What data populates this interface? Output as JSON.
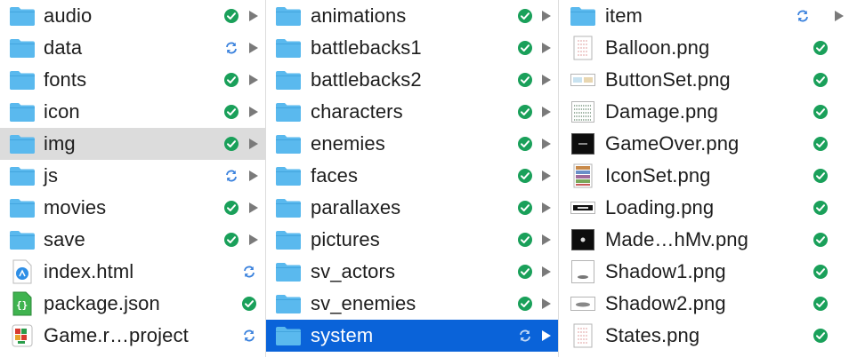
{
  "columns": [
    {
      "items": [
        {
          "name": "audio",
          "kind": "folder",
          "status": "synced",
          "arrow": true
        },
        {
          "name": "data",
          "kind": "folder",
          "status": "syncing",
          "arrow": true
        },
        {
          "name": "fonts",
          "kind": "folder",
          "status": "synced",
          "arrow": true
        },
        {
          "name": "icon",
          "kind": "folder",
          "status": "synced",
          "arrow": true
        },
        {
          "name": "img",
          "kind": "folder",
          "status": "synced",
          "arrow": true,
          "selected": "gray"
        },
        {
          "name": "js",
          "kind": "folder",
          "status": "syncing",
          "arrow": true
        },
        {
          "name": "movies",
          "kind": "folder",
          "status": "synced",
          "arrow": true
        },
        {
          "name": "save",
          "kind": "folder",
          "status": "synced",
          "arrow": true
        },
        {
          "name": "index.html",
          "kind": "html-file",
          "status": "syncing",
          "arrow": false
        },
        {
          "name": "package.json",
          "kind": "json-file",
          "status": "synced",
          "arrow": false
        },
        {
          "name": "Game.r…project",
          "kind": "project-file",
          "status": "syncing",
          "arrow": false
        }
      ]
    },
    {
      "items": [
        {
          "name": "animations",
          "kind": "folder",
          "status": "synced",
          "arrow": true
        },
        {
          "name": "battlebacks1",
          "kind": "folder",
          "status": "synced",
          "arrow": true
        },
        {
          "name": "battlebacks2",
          "kind": "folder",
          "status": "synced",
          "arrow": true
        },
        {
          "name": "characters",
          "kind": "folder",
          "status": "synced",
          "arrow": true
        },
        {
          "name": "enemies",
          "kind": "folder",
          "status": "synced",
          "arrow": true
        },
        {
          "name": "faces",
          "kind": "folder",
          "status": "synced",
          "arrow": true
        },
        {
          "name": "parallaxes",
          "kind": "folder",
          "status": "synced",
          "arrow": true
        },
        {
          "name": "pictures",
          "kind": "folder",
          "status": "synced",
          "arrow": true
        },
        {
          "name": "sv_actors",
          "kind": "folder",
          "status": "synced",
          "arrow": true
        },
        {
          "name": "sv_enemies",
          "kind": "folder",
          "status": "synced",
          "arrow": true
        },
        {
          "name": "system",
          "kind": "folder",
          "status": "syncing",
          "arrow": true,
          "selected": "blue"
        }
      ]
    },
    {
      "items": [
        {
          "name": "item",
          "kind": "folder",
          "status": "syncing",
          "arrow": true
        },
        {
          "name": "Balloon.png",
          "kind": "image-file",
          "thumb": "tall",
          "status": "synced",
          "arrow": false
        },
        {
          "name": "ButtonSet.png",
          "kind": "image-file",
          "thumb": "wide",
          "status": "synced",
          "arrow": false
        },
        {
          "name": "Damage.png",
          "kind": "image-file",
          "thumb": "grid",
          "status": "synced",
          "arrow": false
        },
        {
          "name": "GameOver.png",
          "kind": "image-file",
          "thumb": "dark",
          "status": "synced",
          "arrow": false
        },
        {
          "name": "IconSet.png",
          "kind": "image-file",
          "thumb": "icons",
          "status": "synced",
          "arrow": false
        },
        {
          "name": "Loading.png",
          "kind": "image-file",
          "thumb": "wide-dark",
          "status": "synced",
          "arrow": false
        },
        {
          "name": "Made…hMv.png",
          "kind": "image-file",
          "thumb": "dark-dot",
          "status": "synced",
          "arrow": false
        },
        {
          "name": "Shadow1.png",
          "kind": "image-file",
          "thumb": "shadow",
          "status": "synced",
          "arrow": false
        },
        {
          "name": "Shadow2.png",
          "kind": "image-file",
          "thumb": "wide-shadow",
          "status": "synced",
          "arrow": false
        },
        {
          "name": "States.png",
          "kind": "image-file",
          "thumb": "tall",
          "status": "synced",
          "arrow": false
        }
      ]
    }
  ],
  "colors": {
    "folder": "#5ab9ee",
    "synced": "#1aa05a",
    "syncing": "#3b82dd",
    "selection_blue": "#0a63d9",
    "selection_gray": "#dcdcdc"
  }
}
